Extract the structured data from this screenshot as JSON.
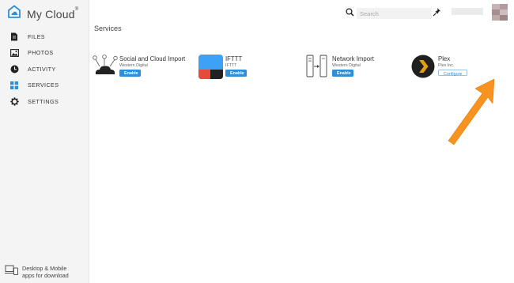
{
  "app": {
    "name": "My Cloud",
    "trademark": "®",
    "accent_color": "#2d8fd8",
    "annotation_arrow_color": "#f7931e"
  },
  "sidebar": {
    "items": [
      {
        "label": "FILES",
        "icon": "file-icon"
      },
      {
        "label": "PHOTOS",
        "icon": "photo-icon"
      },
      {
        "label": "ACTIVITY",
        "icon": "clock-icon"
      },
      {
        "label": "SERVICES",
        "icon": "grid-icon",
        "active": true
      },
      {
        "label": "SETTINGS",
        "icon": "gear-icon"
      }
    ],
    "promo_line1": "Desktop & Mobile",
    "promo_line2": "apps for download"
  },
  "header": {
    "search_placeholder": "Search"
  },
  "main": {
    "title": "Services",
    "services": [
      {
        "title": "Social and Cloud Import",
        "vendor": "Western Digital",
        "button": "Enable",
        "icon": "cloud-network-icon"
      },
      {
        "title": "IFTTT",
        "vendor": "IFTTT",
        "button": "Enable",
        "icon": "ifttt-icon"
      },
      {
        "title": "Network Import",
        "vendor": "Western Digital",
        "button": "Enable",
        "icon": "network-drive-icon"
      },
      {
        "title": "Plex",
        "vendor": "Plex Inc.",
        "button": "Configure",
        "icon": "plex-icon"
      }
    ]
  }
}
